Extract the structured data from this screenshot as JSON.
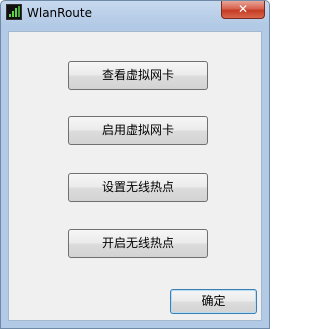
{
  "window": {
    "title": "WlanRoute",
    "close_glyph": "✕",
    "app_icon": "wifi-signal-icon"
  },
  "buttons": {
    "view_virtual_adapter": "查看虚拟网卡",
    "enable_virtual_adapter": "启用虚拟网卡",
    "set_hotspot": "设置无线热点",
    "start_hotspot": "开启无线热点",
    "ok": "确定"
  },
  "colors": {
    "close_button": "#c63c25",
    "titlebar": "#bcd1ea",
    "client_bg": "#f0f0f0"
  }
}
